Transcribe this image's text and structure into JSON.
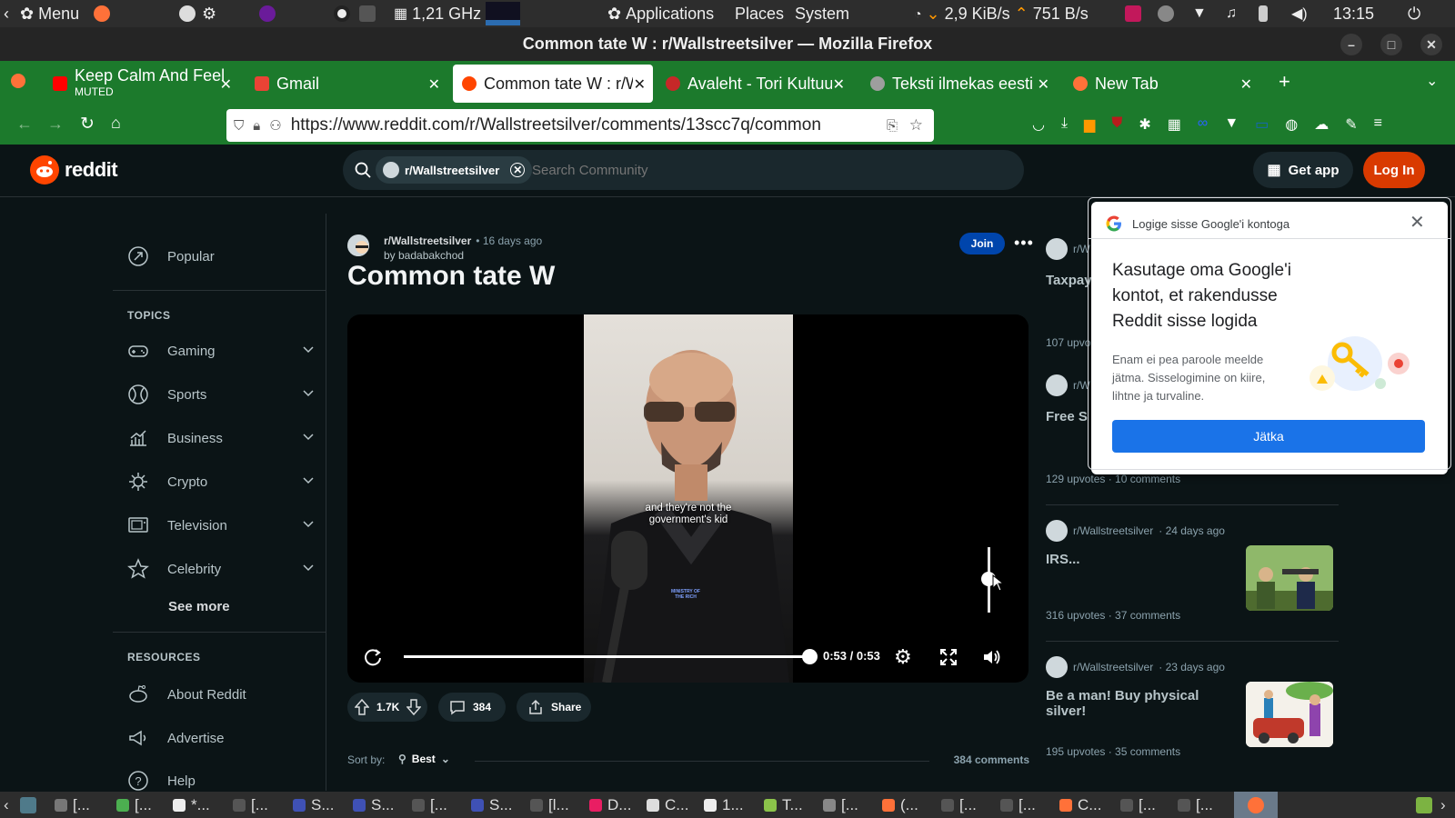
{
  "system_panel": {
    "menu_label": "Menu",
    "cpu_freq": "1,21 GHz",
    "applications": "Applications",
    "places": "Places",
    "system": "System",
    "net_down": "2,9 KiB/s",
    "net_up": "751 B/s",
    "clock": "13:15"
  },
  "window": {
    "title": "Common tate W : r/Wallstreetsilver — Mozilla Firefox"
  },
  "tabs": [
    {
      "label": "Keep Calm And Feel",
      "sublabel": "MUTED",
      "favicon_color": "#ff0000"
    },
    {
      "label": "Gmail",
      "favicon_color": "#ea4335"
    },
    {
      "label": "Common tate W : r/W",
      "favicon_color": "#ff4500",
      "active": true
    },
    {
      "label": "Avaleht - Tori Kultuu",
      "favicon_color": "#c62828"
    },
    {
      "label": "Teksti ilmekas eesti",
      "favicon_color": "#9e9e9e"
    },
    {
      "label": "New Tab",
      "favicon_color": "#ff7139"
    }
  ],
  "nav": {
    "url": "https://www.reddit.com/r/Wallstreetsilver/comments/13scc7q/common"
  },
  "reddit_header": {
    "logo_text": "reddit",
    "community_chip": "r/Wallstreetsilver",
    "search_placeholder": "Search Community",
    "get_app": "Get app",
    "login": "Log In"
  },
  "sidebar": {
    "popular": "Popular",
    "topics_heading": "TOPICS",
    "topics": [
      "Gaming",
      "Sports",
      "Business",
      "Crypto",
      "Television",
      "Celebrity"
    ],
    "see_more": "See more",
    "resources_heading": "RESOURCES",
    "resources": [
      "About Reddit",
      "Advertise",
      "Help"
    ]
  },
  "post": {
    "community": "r/Wallstreetsilver",
    "age": "• 16 days ago",
    "author": "by badabakchod",
    "join": "Join",
    "title": "Common tate W",
    "caption_line1": "and they're not the",
    "caption_line2": "government's kid",
    "mic_logo": "MINISTRY OF THE RICH",
    "time_display": "0:53 / 0:53",
    "progress": 1.0,
    "upvotes": "1.7K",
    "comments": "384",
    "share": "Share",
    "sort_label": "Sort by:",
    "sort_value": "Best",
    "comment_count": "384 comments"
  },
  "related": [
    {
      "community": "r/W",
      "title": "Taxpay",
      "stats": "107 upvo"
    },
    {
      "community": "r/W",
      "title": "Free S",
      "stats": "129 upvotes · 10 comments"
    },
    {
      "community": "r/Wallstreetsilver",
      "age": "· 24 days ago",
      "title": "IRS...",
      "stats": "316 upvotes · 37 comments"
    },
    {
      "community": "r/Wallstreetsilver",
      "age": "· 23 days ago",
      "title": "Be a man! Buy physical silver!",
      "stats": "195 upvotes · 35 comments"
    }
  ],
  "google_popup": {
    "header": "Logige sisse Google'i kontoga",
    "heading": "Kasutage oma Google'i kontot, et rakendusse Reddit sisse logida",
    "body": "Enam ei pea paroole meelde jätma. Sisselogimine on kiire, lihtne ja turvaline.",
    "continue": "Jätka"
  },
  "taskbar": {
    "items": [
      "[...",
      "[...",
      "*...",
      "[...",
      "S...",
      "S...",
      "[...",
      "S...",
      "[l...",
      "D...",
      "C...",
      "1...",
      "T...",
      "[...",
      "(...",
      "[...",
      "[...",
      "C...",
      "[...",
      "[..."
    ]
  },
  "colors": {
    "reddit_orange": "#d93a00",
    "join_blue": "#0045ac",
    "firefox_green": "#1c7a2c",
    "google_blue": "#1a73e8"
  }
}
